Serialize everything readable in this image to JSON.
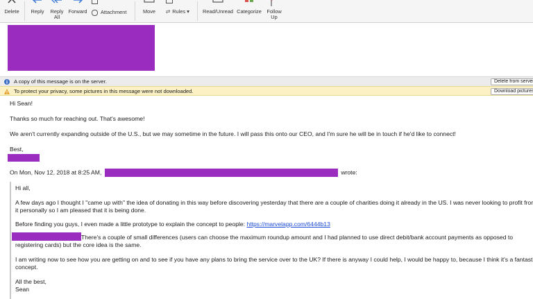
{
  "toolbar": {
    "delete": "Delete",
    "reply": "Reply",
    "reply_all_line1": "Reply",
    "reply_all_line2": "All",
    "forward": "Forward",
    "attachment": "Attachment",
    "move": "Move",
    "rules": "Rules",
    "read_unread": "Read/Unread",
    "categorize": "Categorize",
    "follow_up_line1": "Follow",
    "follow_up_line2": "Up",
    "accent_colors": {
      "reply_arrow": "#3d7ad8",
      "category_red": "#d9534f",
      "follow_flag": "#d9534f"
    }
  },
  "info_bars": {
    "server_text": "A copy of this message is on the server.",
    "server_button": "Delete from server",
    "privacy_text": "To protect your privacy, some pictures in this message were not downloaded.",
    "privacy_button": "Download pictures"
  },
  "body": {
    "greeting": "Hi Sean!",
    "p1": "Thanks so much for reaching out. That's awesome!",
    "p2": "We aren't currently expanding outside of the U.S., but we may sometime in the future. I will pass this onto our CEO, and I'm sure he will be in touch if he'd like to connect!",
    "signoff": "Best,",
    "quote_intro_prefix": "On Mon, Nov 12, 2018 at 8:25 AM,",
    "quote_intro_suffix": "wrote:"
  },
  "quoted": {
    "greeting": "Hi all,",
    "p1_line1": "A few days ago I thought I \"came up with\" the idea of donating in this way before discovering yesterday that there are a couple of charities doing it already in the US. I was never looking to profit from",
    "p1_line2": "it personally so I am pleased that it is being done.",
    "p2_text": "Before finding you guys, I even made a little prototype to explain the concept to people:",
    "p2_link": "https://marvelapp.com/6444b13",
    "p3_line1": "There's a couple of small differences (users can choose the maximum roundup amount and I had planned to use direct debit/bank account payments as opposed to",
    "p3_line2": "registering cards) but the core idea is the same.",
    "p4_line1": "I am writing now to see how you are getting on and to see if you have any plans to bring the service over to the UK? If there is anyway I could help, I would be happy to, because I think it's a fantastic",
    "p4_line2": "concept.",
    "closing": "All the best,",
    "name": "Sean"
  },
  "redaction_color": "#9a2cc0"
}
